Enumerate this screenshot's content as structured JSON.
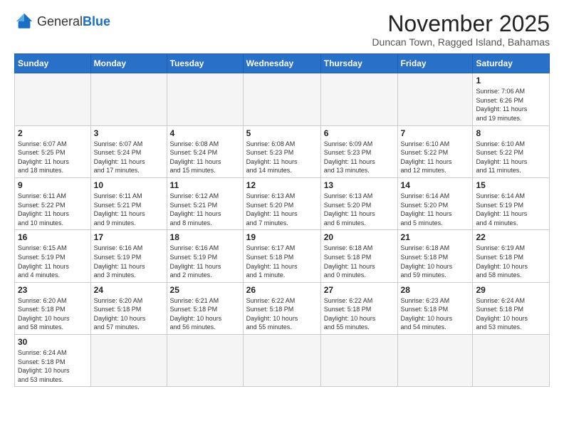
{
  "logo": {
    "general": "General",
    "blue": "Blue"
  },
  "header": {
    "month_year": "November 2025",
    "location": "Duncan Town, Ragged Island, Bahamas"
  },
  "weekdays": [
    "Sunday",
    "Monday",
    "Tuesday",
    "Wednesday",
    "Thursday",
    "Friday",
    "Saturday"
  ],
  "weeks": [
    [
      {
        "day": "",
        "info": ""
      },
      {
        "day": "",
        "info": ""
      },
      {
        "day": "",
        "info": ""
      },
      {
        "day": "",
        "info": ""
      },
      {
        "day": "",
        "info": ""
      },
      {
        "day": "",
        "info": ""
      },
      {
        "day": "1",
        "info": "Sunrise: 7:06 AM\nSunset: 6:26 PM\nDaylight: 11 hours\nand 19 minutes."
      }
    ],
    [
      {
        "day": "2",
        "info": "Sunrise: 6:07 AM\nSunset: 5:25 PM\nDaylight: 11 hours\nand 18 minutes."
      },
      {
        "day": "3",
        "info": "Sunrise: 6:07 AM\nSunset: 5:24 PM\nDaylight: 11 hours\nand 17 minutes."
      },
      {
        "day": "4",
        "info": "Sunrise: 6:08 AM\nSunset: 5:24 PM\nDaylight: 11 hours\nand 15 minutes."
      },
      {
        "day": "5",
        "info": "Sunrise: 6:08 AM\nSunset: 5:23 PM\nDaylight: 11 hours\nand 14 minutes."
      },
      {
        "day": "6",
        "info": "Sunrise: 6:09 AM\nSunset: 5:23 PM\nDaylight: 11 hours\nand 13 minutes."
      },
      {
        "day": "7",
        "info": "Sunrise: 6:10 AM\nSunset: 5:22 PM\nDaylight: 11 hours\nand 12 minutes."
      },
      {
        "day": "8",
        "info": "Sunrise: 6:10 AM\nSunset: 5:22 PM\nDaylight: 11 hours\nand 11 minutes."
      }
    ],
    [
      {
        "day": "9",
        "info": "Sunrise: 6:11 AM\nSunset: 5:22 PM\nDaylight: 11 hours\nand 10 minutes."
      },
      {
        "day": "10",
        "info": "Sunrise: 6:11 AM\nSunset: 5:21 PM\nDaylight: 11 hours\nand 9 minutes."
      },
      {
        "day": "11",
        "info": "Sunrise: 6:12 AM\nSunset: 5:21 PM\nDaylight: 11 hours\nand 8 minutes."
      },
      {
        "day": "12",
        "info": "Sunrise: 6:13 AM\nSunset: 5:20 PM\nDaylight: 11 hours\nand 7 minutes."
      },
      {
        "day": "13",
        "info": "Sunrise: 6:13 AM\nSunset: 5:20 PM\nDaylight: 11 hours\nand 6 minutes."
      },
      {
        "day": "14",
        "info": "Sunrise: 6:14 AM\nSunset: 5:20 PM\nDaylight: 11 hours\nand 5 minutes."
      },
      {
        "day": "15",
        "info": "Sunrise: 6:14 AM\nSunset: 5:19 PM\nDaylight: 11 hours\nand 4 minutes."
      }
    ],
    [
      {
        "day": "16",
        "info": "Sunrise: 6:15 AM\nSunset: 5:19 PM\nDaylight: 11 hours\nand 4 minutes."
      },
      {
        "day": "17",
        "info": "Sunrise: 6:16 AM\nSunset: 5:19 PM\nDaylight: 11 hours\nand 3 minutes."
      },
      {
        "day": "18",
        "info": "Sunrise: 6:16 AM\nSunset: 5:19 PM\nDaylight: 11 hours\nand 2 minutes."
      },
      {
        "day": "19",
        "info": "Sunrise: 6:17 AM\nSunset: 5:18 PM\nDaylight: 11 hours\nand 1 minute."
      },
      {
        "day": "20",
        "info": "Sunrise: 6:18 AM\nSunset: 5:18 PM\nDaylight: 11 hours\nand 0 minutes."
      },
      {
        "day": "21",
        "info": "Sunrise: 6:18 AM\nSunset: 5:18 PM\nDaylight: 10 hours\nand 59 minutes."
      },
      {
        "day": "22",
        "info": "Sunrise: 6:19 AM\nSunset: 5:18 PM\nDaylight: 10 hours\nand 58 minutes."
      }
    ],
    [
      {
        "day": "23",
        "info": "Sunrise: 6:20 AM\nSunset: 5:18 PM\nDaylight: 10 hours\nand 58 minutes."
      },
      {
        "day": "24",
        "info": "Sunrise: 6:20 AM\nSunset: 5:18 PM\nDaylight: 10 hours\nand 57 minutes."
      },
      {
        "day": "25",
        "info": "Sunrise: 6:21 AM\nSunset: 5:18 PM\nDaylight: 10 hours\nand 56 minutes."
      },
      {
        "day": "26",
        "info": "Sunrise: 6:22 AM\nSunset: 5:18 PM\nDaylight: 10 hours\nand 55 minutes."
      },
      {
        "day": "27",
        "info": "Sunrise: 6:22 AM\nSunset: 5:18 PM\nDaylight: 10 hours\nand 55 minutes."
      },
      {
        "day": "28",
        "info": "Sunrise: 6:23 AM\nSunset: 5:18 PM\nDaylight: 10 hours\nand 54 minutes."
      },
      {
        "day": "29",
        "info": "Sunrise: 6:24 AM\nSunset: 5:18 PM\nDaylight: 10 hours\nand 53 minutes."
      }
    ],
    [
      {
        "day": "30",
        "info": "Sunrise: 6:24 AM\nSunset: 5:18 PM\nDaylight: 10 hours\nand 53 minutes."
      },
      {
        "day": "",
        "info": ""
      },
      {
        "day": "",
        "info": ""
      },
      {
        "day": "",
        "info": ""
      },
      {
        "day": "",
        "info": ""
      },
      {
        "day": "",
        "info": ""
      },
      {
        "day": "",
        "info": ""
      }
    ]
  ]
}
